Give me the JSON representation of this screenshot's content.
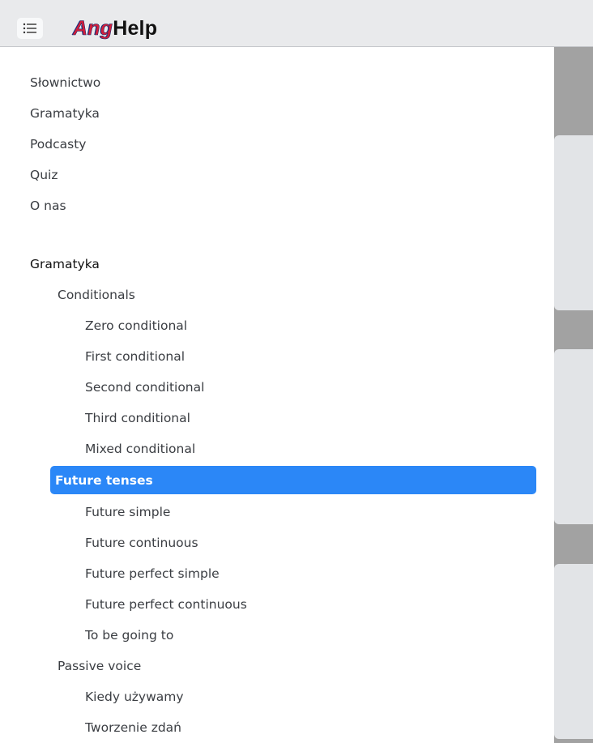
{
  "header": {
    "menu_icon": "list-icon",
    "logo": {
      "part1": "Ang",
      "part2": "Help"
    }
  },
  "nav": {
    "top_links": [
      {
        "label": "Słownictwo"
      },
      {
        "label": "Gramatyka"
      },
      {
        "label": "Podcasty"
      },
      {
        "label": "Quiz"
      },
      {
        "label": "O nas"
      }
    ],
    "section_title": "Gramatyka",
    "groups": [
      {
        "label": "Conditionals",
        "items": [
          {
            "label": "Zero conditional"
          },
          {
            "label": "First conditional"
          },
          {
            "label": "Second conditional"
          },
          {
            "label": "Third conditional"
          },
          {
            "label": "Mixed conditional"
          }
        ]
      },
      {
        "label": "Future tenses",
        "active": true,
        "items": [
          {
            "label": "Future simple"
          },
          {
            "label": "Future continuous"
          },
          {
            "label": "Future perfect simple"
          },
          {
            "label": "Future perfect continuous"
          },
          {
            "label": "To be going to"
          }
        ]
      },
      {
        "label": "Passive voice",
        "items": [
          {
            "label": "Kiedy używamy"
          },
          {
            "label": "Tworzenie zdań"
          }
        ]
      }
    ]
  },
  "colors": {
    "header_bg": "#e9eaec",
    "active_bg": "#2b87f7",
    "active_text": "#ffffff",
    "text": "#3a3d42",
    "right_panel_dark": "#a2a2a2",
    "right_panel_light": "#e2e4e7"
  }
}
